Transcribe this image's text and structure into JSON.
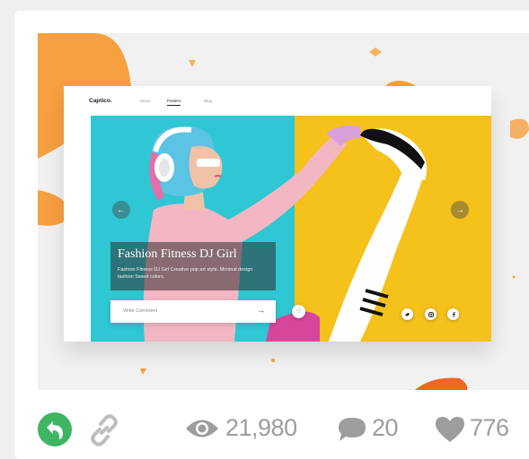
{
  "mockup": {
    "logo": "Captico.",
    "nav": [
      "About",
      "Posters",
      "Blog"
    ],
    "caption_title": "Fashion Fitness DJ Girl",
    "caption_desc": "Fashion Fitness DJ Girl Creative pop art style. Minimal design fashion Sweet colors.",
    "comment_placeholder": "Write Comment",
    "social": [
      "twitter",
      "instagram",
      "facebook"
    ]
  },
  "stats": {
    "views": "21,980",
    "comments": "20",
    "likes": "776"
  },
  "colors": {
    "cyan": "#2ec7d3",
    "yellow": "#f5c11b",
    "orange": "#f7a040",
    "green": "#3db561"
  },
  "icons": [
    "rebound-icon",
    "link-icon",
    "eye-icon",
    "comment-icon",
    "heart-icon"
  ]
}
